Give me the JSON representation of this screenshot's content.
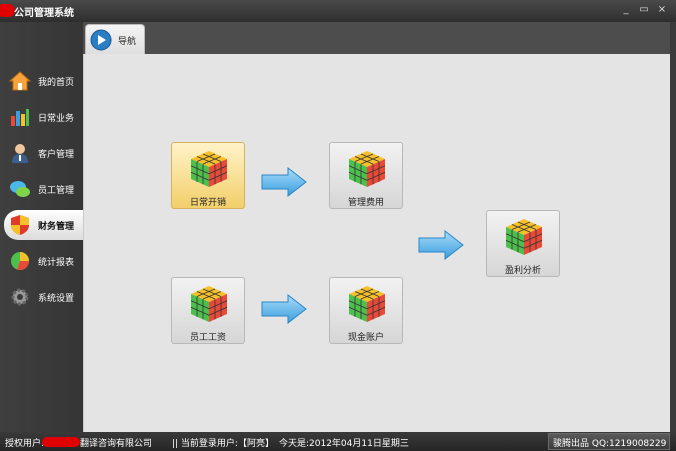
{
  "window": {
    "title": "公司管理系统",
    "controls": {
      "minimize": "_",
      "maximize": "▭",
      "close": "×"
    }
  },
  "sidebar": {
    "items": [
      {
        "label": "我的首页",
        "icon": "home-icon"
      },
      {
        "label": "日常业务",
        "icon": "bar-chart-icon"
      },
      {
        "label": "客户管理",
        "icon": "user-icon"
      },
      {
        "label": "员工管理",
        "icon": "chat-bubbles-icon"
      },
      {
        "label": "财务管理",
        "icon": "shield-icon",
        "active": true
      },
      {
        "label": "统计报表",
        "icon": "pie-chart-icon"
      },
      {
        "label": "系统设置",
        "icon": "gear-icon"
      }
    ]
  },
  "tabs": [
    {
      "label": "导航",
      "icon": "play-icon",
      "active": true
    }
  ],
  "flow": {
    "nodes": [
      {
        "label": "日常开销",
        "icon": "rubik-cube-icon",
        "highlighted": true
      },
      {
        "label": "管理费用",
        "icon": "rubik-cube-icon"
      },
      {
        "label": "盈利分析",
        "icon": "rubik-cube-icon"
      },
      {
        "label": "员工工资",
        "icon": "rubik-cube-icon"
      },
      {
        "label": "现金账户",
        "icon": "rubik-cube-icon"
      }
    ],
    "arrows": [
      "arrow-right-icon",
      "arrow-right-icon",
      "arrow-right-icon"
    ]
  },
  "statusbar": {
    "auth_user_label": "授权用户:",
    "company_suffix": "翻译咨询有限公司",
    "current_user": "|| 当前登录用户:【阿亮】",
    "today": "今天是:2012年04月11日星期三",
    "credit": "骏腾出品 QQ:1219008229"
  },
  "colors": {
    "accent_highlight": "#f2cf6a",
    "redaction": "#e00000",
    "arrow_blue": "#3a9ee0"
  }
}
